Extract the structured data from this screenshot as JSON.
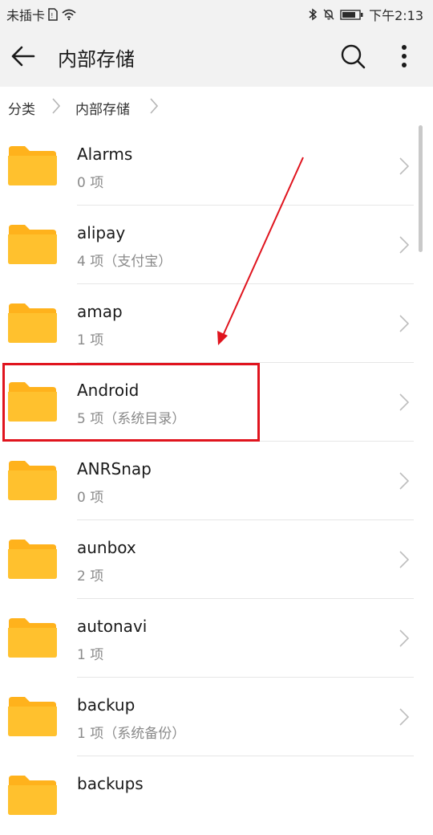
{
  "status_bar": {
    "carrier": "未插卡",
    "time": "下午2:13"
  },
  "app_bar": {
    "title": "内部存储",
    "back_icon": "arrow-left-icon",
    "search_icon": "search-icon",
    "more_icon": "more-vertical-icon"
  },
  "breadcrumb": {
    "items": [
      "分类",
      "内部存储"
    ]
  },
  "folders": [
    {
      "name": "Alarms",
      "detail": "0 项"
    },
    {
      "name": "alipay",
      "detail": "4 项（支付宝）"
    },
    {
      "name": "amap",
      "detail": "1 项"
    },
    {
      "name": "Android",
      "detail": "5 项（系统目录）"
    },
    {
      "name": "ANRSnap",
      "detail": "0 项"
    },
    {
      "name": "aunbox",
      "detail": "2 项"
    },
    {
      "name": "autonavi",
      "detail": "1 项"
    },
    {
      "name": "backup",
      "detail": "1 项（系统备份）"
    },
    {
      "name": "backups",
      "detail": ""
    }
  ],
  "colors": {
    "folder": "#FFC12E",
    "folder_tab": "#FFB21C",
    "annotation": "#E0141E"
  }
}
